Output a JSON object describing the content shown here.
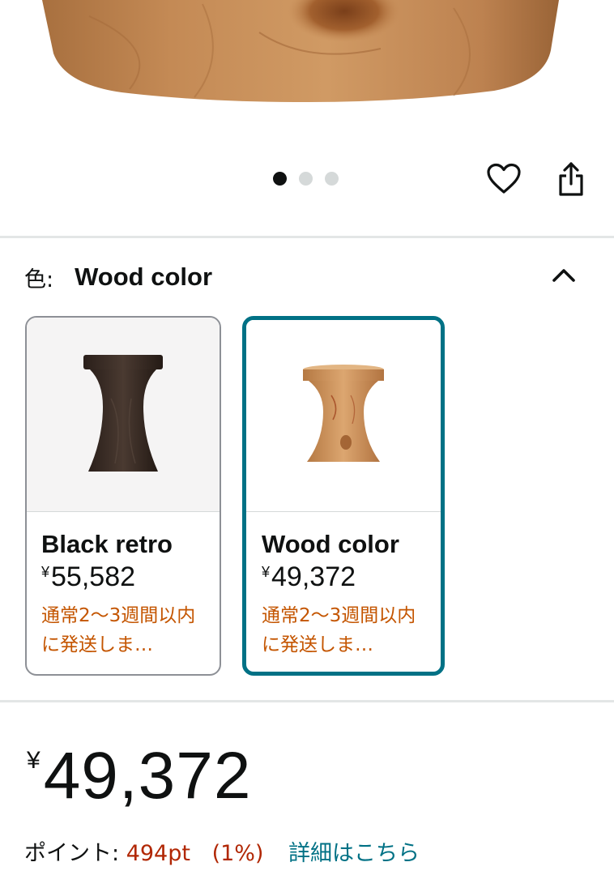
{
  "carousel": {
    "dots": [
      {
        "active": true
      },
      {
        "active": false
      },
      {
        "active": false
      }
    ]
  },
  "actions": {
    "wishlist_icon": "heart-icon",
    "share_icon": "share-icon"
  },
  "color_selector": {
    "label": "色:",
    "selected_value": "Wood color",
    "toggle_icon": "chevron-up-icon",
    "options": [
      {
        "name": "Black retro",
        "currency": "¥",
        "price": "55,582",
        "shipping": "通常2～3週間以内に発送しま…",
        "selected": false
      },
      {
        "name": "Wood color",
        "currency": "¥",
        "price": "49,372",
        "shipping": "通常2～3週間以内に発送しま…",
        "selected": true
      }
    ]
  },
  "price": {
    "currency": "¥",
    "amount": "49,372"
  },
  "points": {
    "label": "ポイント:",
    "value": "494pt",
    "percent": "(1%)",
    "details_link": "詳細はこちら"
  },
  "colors": {
    "accent": "#007185",
    "shipping_text": "#c45500",
    "points_text": "#b12704",
    "selected_border": "#007185"
  }
}
